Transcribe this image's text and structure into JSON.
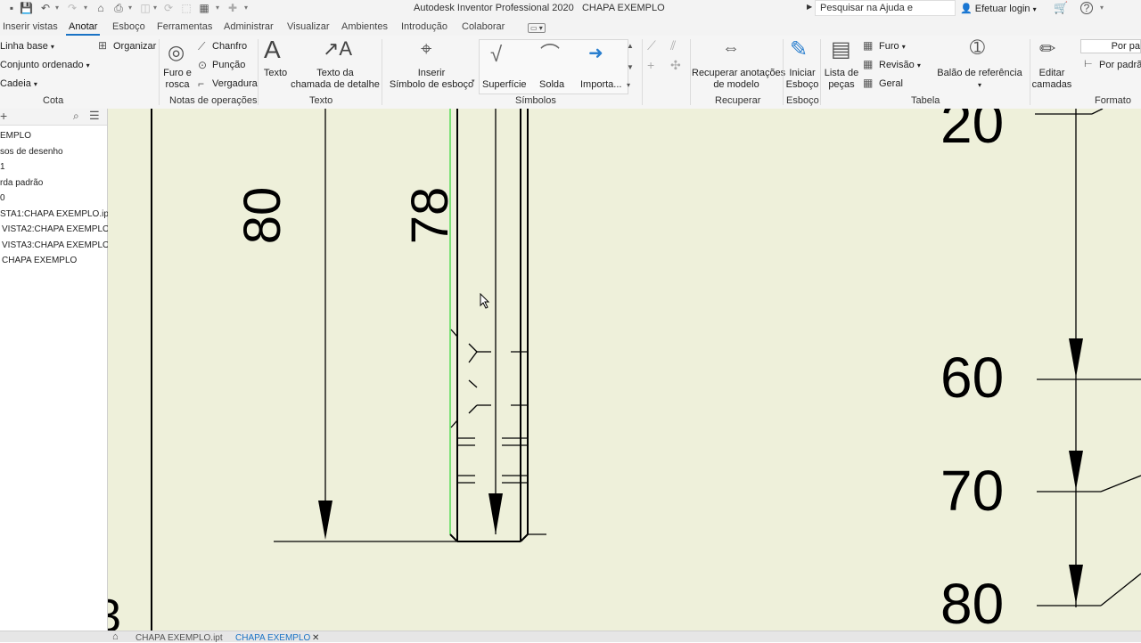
{
  "title": {
    "app": "Autodesk Inventor Professional 2020",
    "document": "CHAPA EXEMPLO"
  },
  "search": {
    "label": "Pesquisar na Ajuda e comandos..."
  },
  "account": {
    "login": "Efetuar login"
  },
  "tabs": [
    "Inserir vistas",
    "Anotar",
    "Esboço",
    "Ferramentas",
    "Administrar",
    "Visualizar",
    "Ambientes",
    "Introdução",
    "Colaborar"
  ],
  "active_tab": "Anotar",
  "ribbon": {
    "cota": {
      "label": "Cota",
      "items": [
        "Linha base",
        "Conjunto ordenado",
        "Cadeia",
        "Organizar"
      ]
    },
    "notas": {
      "label": "Notas de operações",
      "furo_line1": "Furo e",
      "furo_line2": "rosca",
      "chanfro": "Chanfro",
      "puncao": "Punção",
      "vergadura": "Vergadura"
    },
    "texto": {
      "label": "Texto",
      "texto": "Texto",
      "chamada_line1": "Texto da",
      "chamada_line2": "chamada de detalhe"
    },
    "simbolos": {
      "label": "Símbolos",
      "inserir_line1": "Inserir",
      "inserir_line2": "Símbolo de esboço",
      "superficie": "Superfície",
      "solda": "Solda",
      "importa": "Importa..."
    },
    "recuperar": {
      "label": "Recuperar",
      "line1": "Recuperar anotações",
      "line2": "de modelo"
    },
    "esboco": {
      "label": "Esboço",
      "line1": "Iniciar",
      "line2": "Esboço"
    },
    "tabela": {
      "label": "Tabela",
      "lista_line1": "Lista de",
      "lista_line2": "peças",
      "furo": "Furo",
      "revisao": "Revisão",
      "geral": "Geral",
      "balao": "Balão de referência"
    },
    "formato": {
      "label": "Formato",
      "editar_line1": "Editar",
      "editar_line2": "camadas",
      "por_pa1": "Por pa",
      "por_padrao": "Por padrã"
    }
  },
  "browser": {
    "items": [
      "EMPLO",
      "sos de desenho",
      "1",
      "rda padrão",
      "0",
      "STA1:CHAPA EXEMPLO.ipt",
      "VISTA2:CHAPA EXEMPLO.ip",
      "VISTA3:CHAPA EXEMPLO.ip",
      "CHAPA EXEMPLO"
    ]
  },
  "drawing": {
    "dims_vertical": [
      "80",
      "78"
    ],
    "dims_right": [
      "20",
      "60",
      "70",
      "80"
    ],
    "partial_left": "3"
  },
  "doc_tabs": [
    "CHAPA EXEMPLO.ipt",
    "CHAPA EXEMPLO"
  ],
  "colors": {
    "canvas": "#eef0da",
    "accent": "#1a73c5",
    "highlight": "#55dd55"
  }
}
